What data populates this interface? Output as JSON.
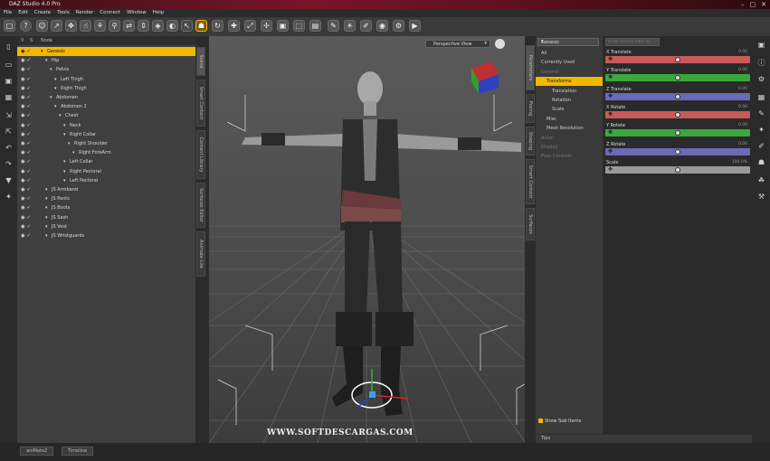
{
  "app": {
    "title": "DAZ Studio 4.0 Pro"
  },
  "menu": [
    "File",
    "Edit",
    "Create",
    "Tools",
    "Render",
    "Connect",
    "Window",
    "Help"
  ],
  "scene": {
    "columns": [
      "V",
      "S",
      "Node"
    ],
    "nodes": [
      {
        "label": "Genesis",
        "level": 0,
        "selected": true
      },
      {
        "label": "Hip",
        "level": 1
      },
      {
        "label": "Pelvis",
        "level": 2
      },
      {
        "label": "Left Thigh",
        "level": 3
      },
      {
        "label": "Right Thigh",
        "level": 3
      },
      {
        "label": "Abdomen",
        "level": 2
      },
      {
        "label": "Abdomen 2",
        "level": 3
      },
      {
        "label": "Chest",
        "level": 4
      },
      {
        "label": "Neck",
        "level": 5
      },
      {
        "label": "Right Collar",
        "level": 5
      },
      {
        "label": "Right Shoulder",
        "level": 6
      },
      {
        "label": "Right ForeArm",
        "level": 7
      },
      {
        "label": "Left Collar",
        "level": 5
      },
      {
        "label": "Right Pectoral",
        "level": 5
      },
      {
        "label": "Left Pectoral",
        "level": 5
      },
      {
        "label": "JS Armband",
        "level": 1
      },
      {
        "label": "JS Pants",
        "level": 1
      },
      {
        "label": "JS Boots",
        "level": 1
      },
      {
        "label": "JS Sash",
        "level": 1
      },
      {
        "label": "JS Vest",
        "level": 1
      },
      {
        "label": "JS Wristguards",
        "level": 1
      }
    ]
  },
  "left_tabs": [
    "Scene",
    "Smart Content",
    "Content Library",
    "Surfaces Editor",
    "Animate Lite"
  ],
  "viewport": {
    "view_label": "Perspective View",
    "watermark": "WWW.SOFTDESCARGAS.COM"
  },
  "right_tabs": [
    "Parameters",
    "Posing",
    "Shaping",
    "Smart Content",
    "Surfaces"
  ],
  "params": {
    "group": "Genesis",
    "filter_placeholder": "Enter text to filter by",
    "tree": [
      {
        "label": "All",
        "indent": 0
      },
      {
        "label": "Currently Used",
        "indent": 0
      },
      {
        "label": "General",
        "indent": 0,
        "dim": true
      },
      {
        "label": "Transforms",
        "indent": 1,
        "on": true
      },
      {
        "label": "Translation",
        "indent": 2
      },
      {
        "label": "Rotation",
        "indent": 2
      },
      {
        "label": "Scale",
        "indent": 2
      },
      {
        "label": "Misc",
        "indent": 1
      },
      {
        "label": "Mesh Resolution",
        "indent": 1
      },
      {
        "label": "Actor",
        "indent": 0,
        "dim": true
      },
      {
        "label": "Display",
        "indent": 0,
        "dim": true
      },
      {
        "label": "Pose Controls",
        "indent": 0,
        "dim": true
      }
    ],
    "sliders": [
      {
        "name": "X Translate",
        "value": "0.00",
        "color": "#c85a5a",
        "pos": 0.5
      },
      {
        "name": "Y Translate",
        "value": "0.00",
        "color": "#3aa83a",
        "pos": 0.5
      },
      {
        "name": "Z Translate",
        "value": "0.00",
        "color": "#6a6ab8",
        "pos": 0.5
      },
      {
        "name": "X Rotate",
        "value": "0.00",
        "color": "#c85a5a",
        "pos": 0.5
      },
      {
        "name": "Y Rotate",
        "value": "0.00",
        "color": "#3aa83a",
        "pos": 0.5
      },
      {
        "name": "Z Rotate",
        "value": "0.00",
        "color": "#6a6ab8",
        "pos": 0.5
      },
      {
        "name": "Scale",
        "value": "100.0%",
        "color": "#9a9a9a",
        "pos": 0.5
      }
    ],
    "show_sub_items": "Show Sub Items",
    "tips": "Tips"
  },
  "bottom_tabs": [
    "aniMate2",
    "Timeline"
  ],
  "colors": {
    "accent": "#f0b800"
  }
}
